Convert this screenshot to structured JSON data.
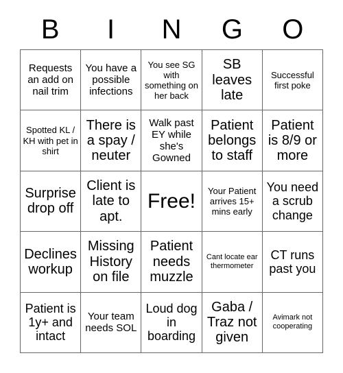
{
  "header": {
    "letters": [
      "B",
      "I",
      "N",
      "G",
      "O"
    ]
  },
  "grid": {
    "rows": 5,
    "columns": 5,
    "line_color": "#666666",
    "background_color": "#ffffff",
    "text_color": "#000000",
    "cells": [
      {
        "text": "Requests an add on nail trim",
        "size": "fs-md",
        "free": false
      },
      {
        "text": "You have a possible infections",
        "size": "fs-md",
        "free": false
      },
      {
        "text": "You see SG with something on her back",
        "size": "fs-sm",
        "free": false
      },
      {
        "text": "SB leaves late",
        "size": "fs-xl",
        "free": false
      },
      {
        "text": "Successful first poke",
        "size": "fs-sm",
        "free": false
      },
      {
        "text": "Spotted KL / KH with pet in shirt",
        "size": "fs-sm",
        "free": false
      },
      {
        "text": "There is a spay / neuter",
        "size": "fs-xl",
        "free": false
      },
      {
        "text": "Walk past EY while she's Gowned",
        "size": "fs-md",
        "free": false
      },
      {
        "text": "Patient belongs to staff",
        "size": "fs-xl",
        "free": false
      },
      {
        "text": "Patient is 8/9 or more",
        "size": "fs-xl",
        "free": false
      },
      {
        "text": "Surprise drop off",
        "size": "fs-xl",
        "free": false
      },
      {
        "text": "Client is late to apt.",
        "size": "fs-xl",
        "free": false
      },
      {
        "text": "Free!",
        "size": "fs-free",
        "free": true
      },
      {
        "text": "Your Patient arrives 15+ mins early",
        "size": "fs-sm",
        "free": false
      },
      {
        "text": "You need a scrub change",
        "size": "fs-lg",
        "free": false
      },
      {
        "text": "Declines workup",
        "size": "fs-xl",
        "free": false
      },
      {
        "text": "Missing History on file",
        "size": "fs-xl",
        "free": false
      },
      {
        "text": "Patient needs muzzle",
        "size": "fs-xl",
        "free": false
      },
      {
        "text": "Cant locate ear thermometer",
        "size": "fs-xs",
        "free": false
      },
      {
        "text": "CT runs past you",
        "size": "fs-lg",
        "free": false
      },
      {
        "text": "Patient is 1y+ and intact",
        "size": "fs-lg",
        "free": false
      },
      {
        "text": "Your team needs SOL",
        "size": "fs-md",
        "free": false
      },
      {
        "text": "Loud dog in boarding",
        "size": "fs-lg",
        "free": false
      },
      {
        "text": "Gaba / Traz not given",
        "size": "fs-xl",
        "free": false
      },
      {
        "text": "Avimark not cooperating",
        "size": "fs-xs",
        "free": false
      }
    ]
  }
}
